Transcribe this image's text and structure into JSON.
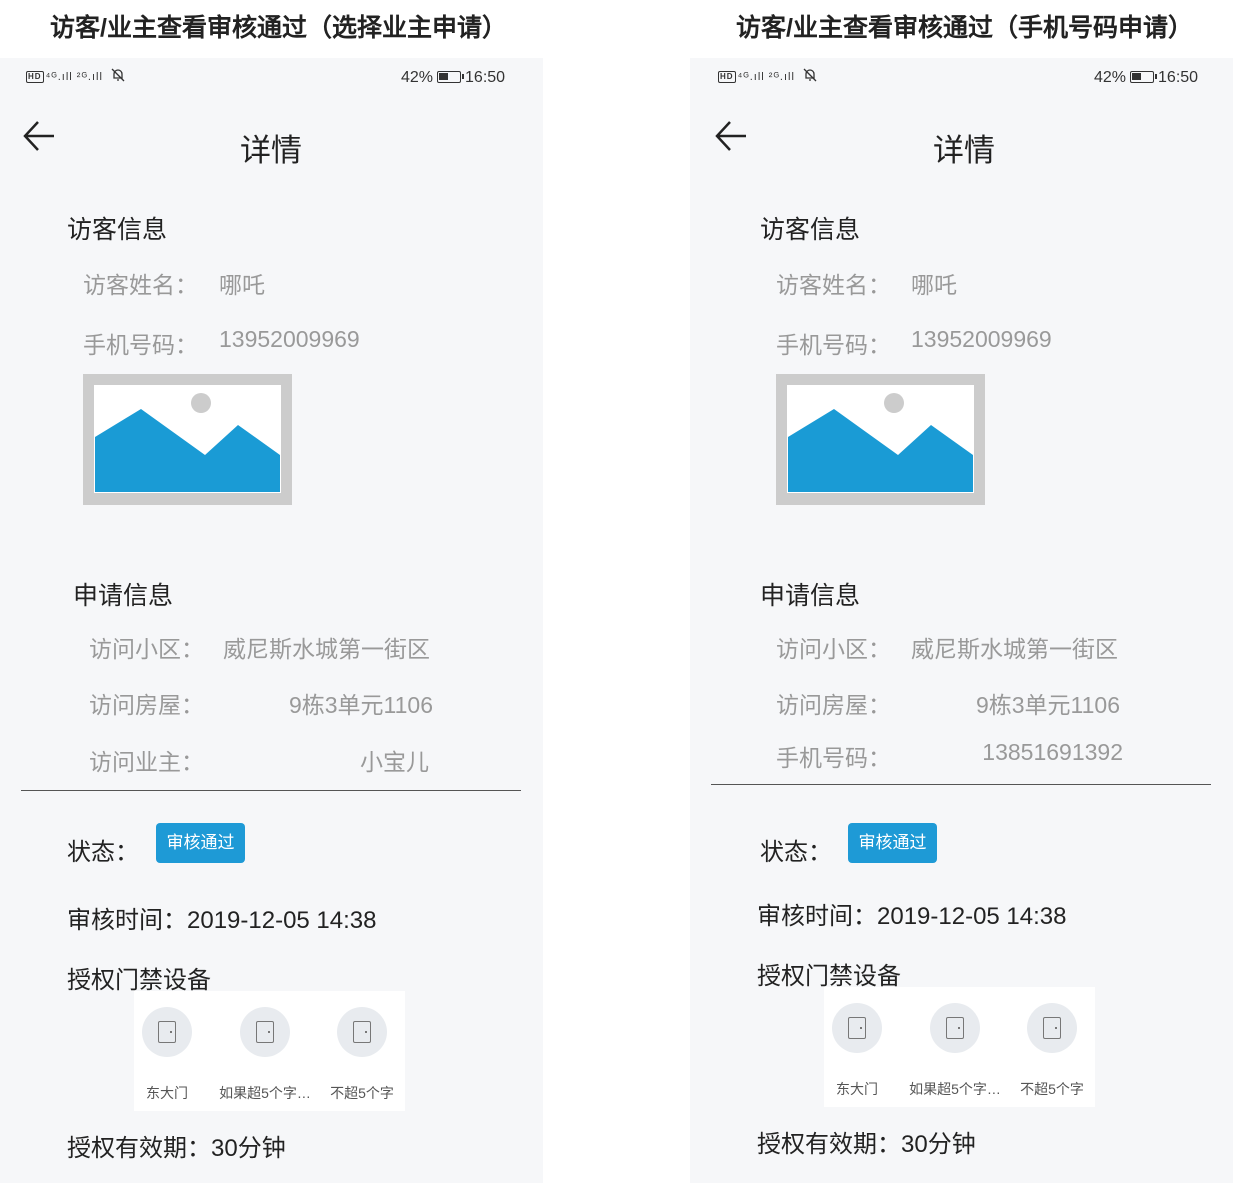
{
  "screens": [
    {
      "heading": "访客/业主查看审核通过（选择业主申请）",
      "status": {
        "left_text": "⁴ᴳ.ıll ²ᴳ.ıll",
        "battery": "42%",
        "time": "16:50"
      },
      "nav_title": "详情",
      "visitor_section": "访客信息",
      "visitor_name_label": "访客姓名：",
      "visitor_name": "哪吒",
      "visitor_phone_label": "手机号码：",
      "visitor_phone": "13952009969",
      "apply_section": "申请信息",
      "community_label": "访问小区：",
      "community": "威尼斯水城第一街区",
      "house_label": "访问房屋：",
      "house": "9栋3单元1106",
      "third_label": "访问业主：",
      "third_value": "小宝儿",
      "status_label": "状态：",
      "status_badge": "审核通过",
      "audit_time": "审核时间：2019-12-05 14:38",
      "devices_title": "授权门禁设备",
      "devices": [
        "东大门",
        "如果超5个字…",
        "不超5个字"
      ],
      "validity": "授权有效期：30分钟"
    },
    {
      "heading": "访客/业主查看审核通过（手机号码申请）",
      "status": {
        "left_text": "⁴ᴳ.ıll ²ᴳ.ıll",
        "battery": "42%",
        "time": "16:50"
      },
      "nav_title": "详情",
      "visitor_section": "访客信息",
      "visitor_name_label": "访客姓名：",
      "visitor_name": "哪吒",
      "visitor_phone_label": "手机号码：",
      "visitor_phone": "13952009969",
      "apply_section": "申请信息",
      "community_label": "访问小区：",
      "community": "威尼斯水城第一街区",
      "house_label": "访问房屋：",
      "house": "9栋3单元1106",
      "third_label": "手机号码：",
      "third_value": "13851691392",
      "status_label": "状态：",
      "status_badge": "审核通过",
      "audit_time": "审核时间：2019-12-05 14:38",
      "devices_title": "授权门禁设备",
      "devices": [
        "东大门",
        "如果超5个字…",
        "不超5个字"
      ],
      "validity": "授权有效期：30分钟"
    }
  ],
  "colors": {
    "accent": "#1e9ad6",
    "background": "#f6f7f9",
    "muted_text": "#999999"
  },
  "icons": [
    "back-arrow-icon",
    "signal-icon",
    "mute-bell-icon",
    "battery-icon",
    "door-icon",
    "image-placeholder-icon"
  ]
}
